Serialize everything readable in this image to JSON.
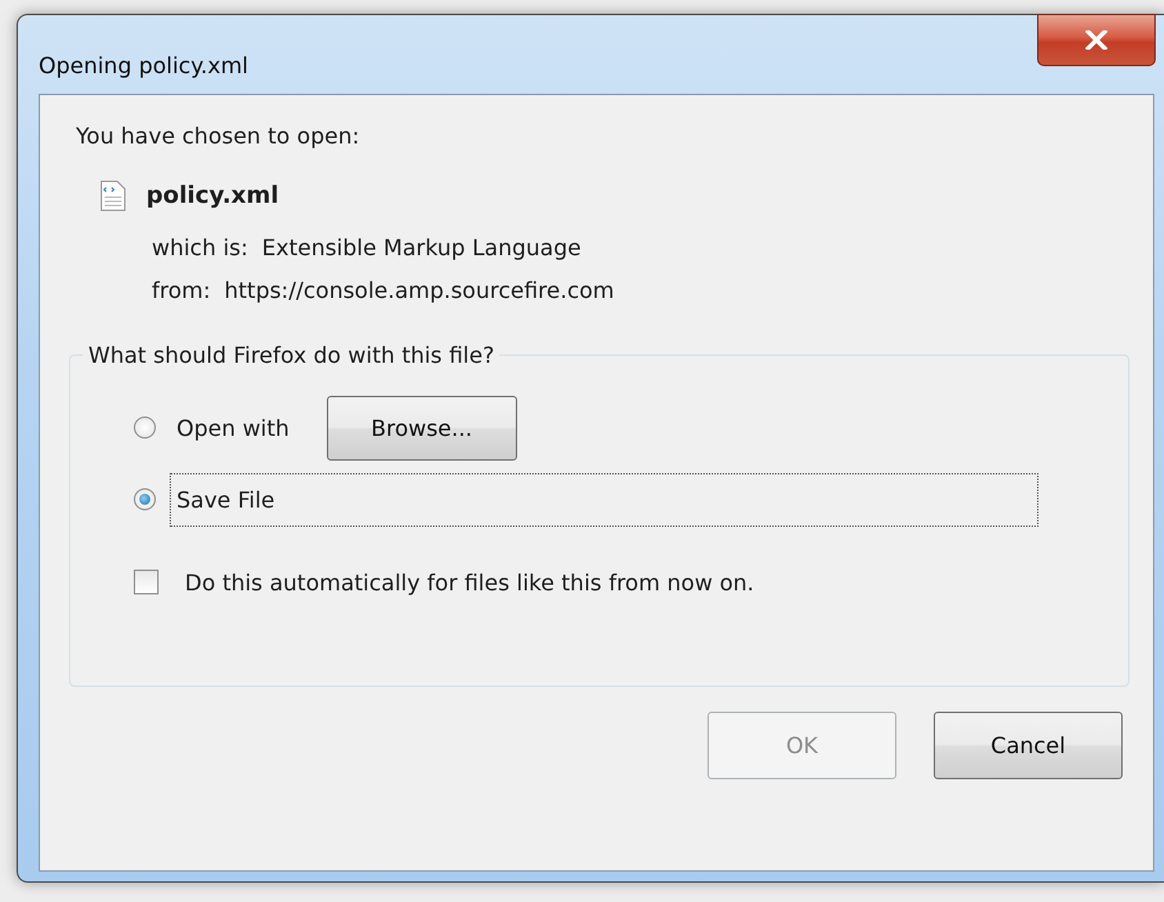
{
  "window": {
    "title": "Opening policy.xml"
  },
  "intro": "You have chosen to open:",
  "file": {
    "name": "policy.xml",
    "details": [
      {
        "label": "which is:",
        "value": "Extensible Markup Language"
      },
      {
        "label": "from:",
        "value": "https://console.amp.sourcefire.com"
      }
    ]
  },
  "action_group": {
    "legend": "What should Firefox do with this file?",
    "options": [
      {
        "label": "Open with",
        "selected": false,
        "focused": false,
        "button": "Browse..."
      },
      {
        "label": "Save File",
        "selected": true,
        "focused": true
      }
    ],
    "remember": {
      "label": "Do this automatically for files like this from now on.",
      "checked": false
    }
  },
  "buttons": [
    {
      "label": "OK",
      "disabled": true
    },
    {
      "label": "Cancel",
      "disabled": false
    }
  ]
}
